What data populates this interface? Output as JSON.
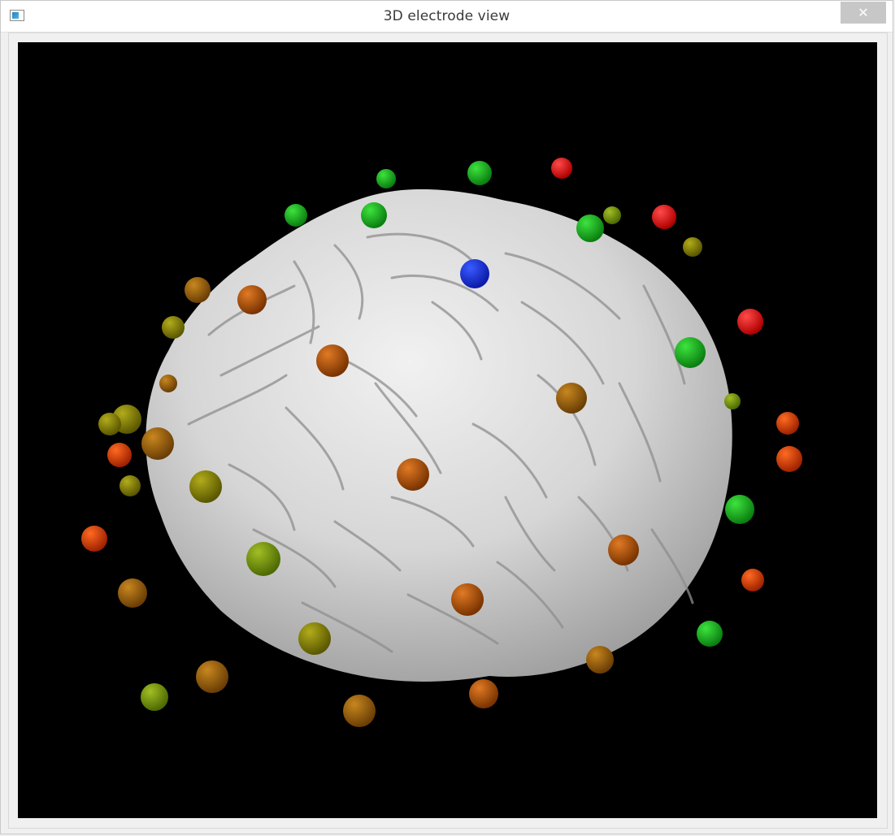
{
  "window": {
    "title": "3D electrode view",
    "app_icon": "window-app-icon",
    "close_icon": "close-icon",
    "close_symbol": "✕"
  },
  "viewport": {
    "background": "#000000",
    "surface_color": "#d9d9d9",
    "electrode_colors": {
      "blue": "#0a1ef0",
      "red": "#ff1a1a",
      "green": "#13b81a",
      "orange": "#c45a06",
      "brown": "#a3650c",
      "olive": "#8a860a",
      "yellow_green": "#7f9a0f"
    }
  }
}
